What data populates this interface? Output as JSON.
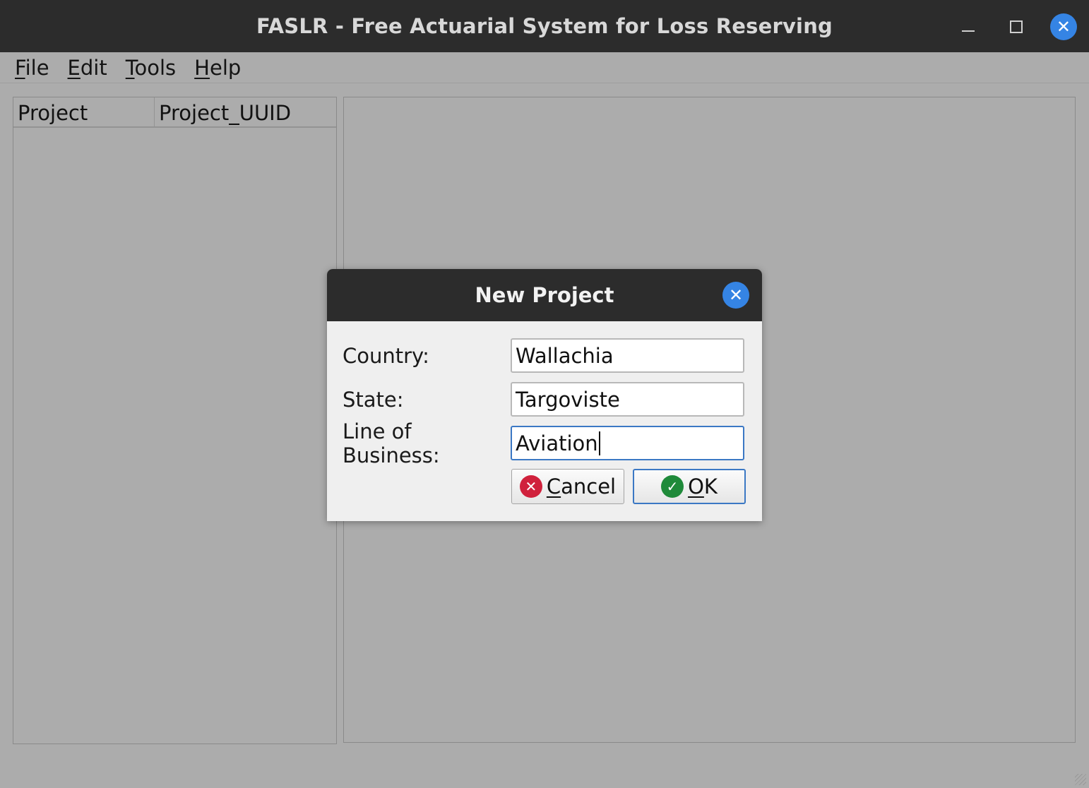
{
  "window": {
    "title": "FASLR - Free Actuarial System for Loss Reserving",
    "close_symbol": "✕"
  },
  "menu": {
    "items": [
      {
        "mnemonic": "F",
        "rest": "ile"
      },
      {
        "mnemonic": "E",
        "rest": "dit"
      },
      {
        "mnemonic": "T",
        "rest": "ools"
      },
      {
        "mnemonic": "H",
        "rest": "elp"
      }
    ]
  },
  "project_table": {
    "columns": [
      "Project",
      "Project_UUID"
    ]
  },
  "dialog": {
    "title": "New Project",
    "close_symbol": "✕",
    "fields": {
      "country": {
        "label": "Country:",
        "value": "Wallachia"
      },
      "state": {
        "label": "State:",
        "value": "Targoviste"
      },
      "lob": {
        "label": "Line of Business:",
        "value": "Aviation"
      }
    },
    "cancel": {
      "mnemonic": "C",
      "rest": "ancel",
      "icon_symbol": "✕",
      "icon": "cancel-x-icon",
      "icon_color": "#d0213c"
    },
    "ok": {
      "mnemonic": "O",
      "rest": "K",
      "icon_symbol": "✓",
      "icon": "check-icon",
      "icon_color": "#1f8a3a"
    }
  },
  "colors": {
    "accent": "#3584e4",
    "titlebar": "#2c2c2c",
    "background": "#acacac",
    "dialog_bg": "#efefef",
    "focus_border": "#3b78c4"
  }
}
